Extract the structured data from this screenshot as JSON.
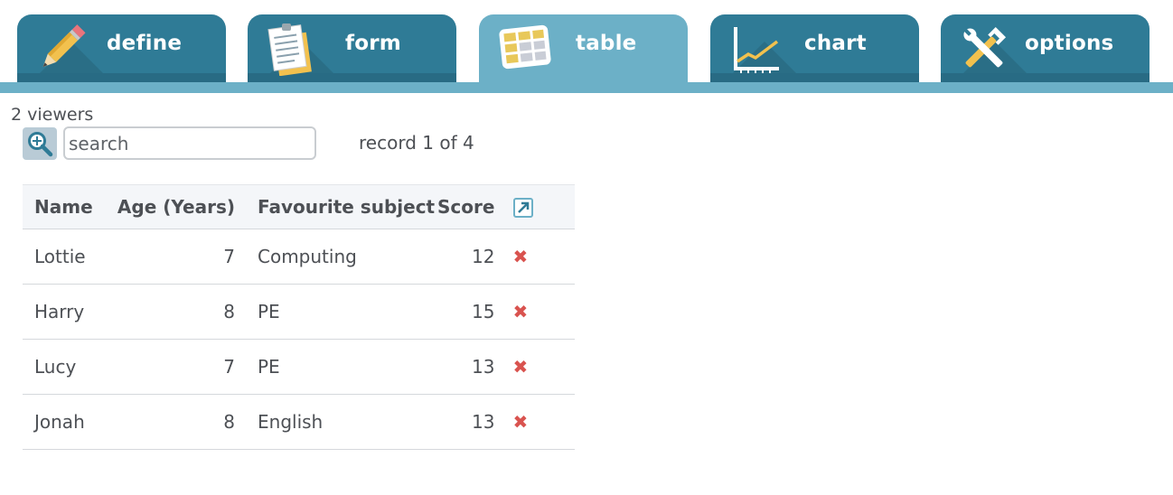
{
  "tabs": [
    {
      "id": "define",
      "label": "define",
      "icon": "pencil-icon",
      "active": false
    },
    {
      "id": "form",
      "label": "form",
      "icon": "notepad-icon",
      "active": false
    },
    {
      "id": "table",
      "label": "table",
      "icon": "table-grid-icon",
      "active": true
    },
    {
      "id": "chart",
      "label": "chart",
      "icon": "line-chart-icon",
      "active": false
    },
    {
      "id": "options",
      "label": "options",
      "icon": "tools-icon",
      "active": false
    }
  ],
  "viewers": "2 viewers",
  "search": {
    "placeholder": "search",
    "value": ""
  },
  "record": "record 1 of 4",
  "table": {
    "columns": [
      "Name",
      "Age (Years)",
      "Favourite subject",
      "Score"
    ],
    "rows": [
      {
        "name": "Lottie",
        "age": "7",
        "subject": "Computing",
        "score": "12"
      },
      {
        "name": "Harry",
        "age": "8",
        "subject": "PE",
        "score": "15"
      },
      {
        "name": "Lucy",
        "age": "7",
        "subject": "PE",
        "score": "13"
      },
      {
        "name": "Jonah",
        "age": "8",
        "subject": "English",
        "score": "13"
      }
    ],
    "delete_symbol": "✖"
  },
  "colors": {
    "tab": "#2f7b96",
    "tab_active": "#6cb0c7",
    "delete": "#d9534f",
    "header_bg": "#f4f6f9"
  }
}
